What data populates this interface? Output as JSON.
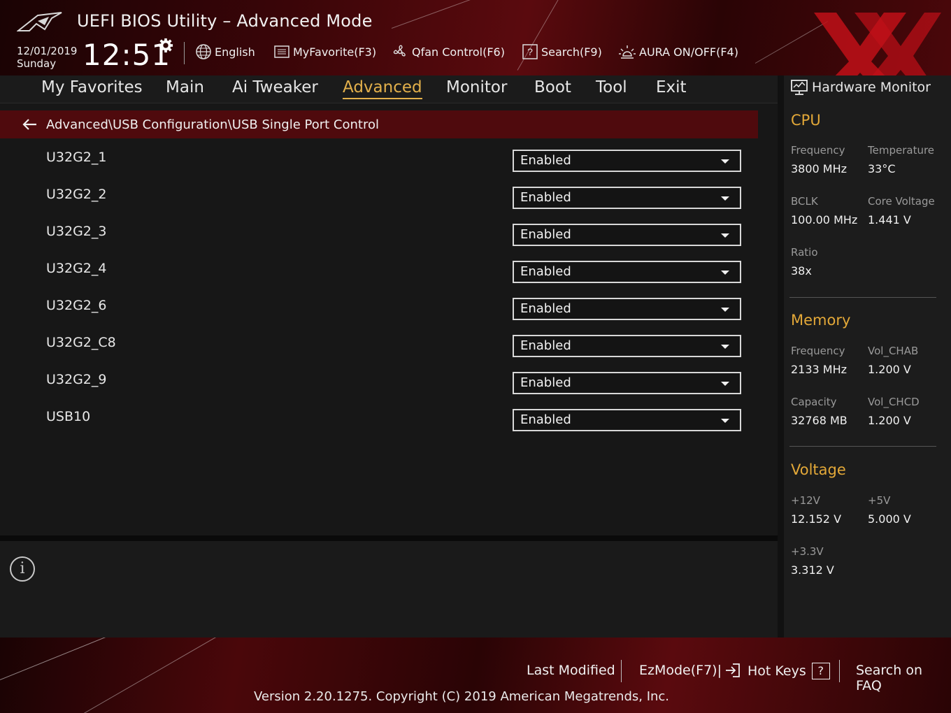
{
  "header": {
    "title": "UEFI BIOS Utility – Advanced Mode",
    "date": "12/01/2019",
    "day": "Sunday",
    "time": "12:51",
    "toolbar": {
      "language": "English",
      "myfavorite": "MyFavorite(F3)",
      "qfan": "Qfan Control(F6)",
      "search": "Search(F9)",
      "aura": "AURA ON/OFF(F4)"
    }
  },
  "tabs": [
    {
      "label": "My Favorites"
    },
    {
      "label": "Main"
    },
    {
      "label": "Ai Tweaker"
    },
    {
      "label": "Advanced",
      "active": true
    },
    {
      "label": "Monitor"
    },
    {
      "label": "Boot"
    },
    {
      "label": "Tool"
    },
    {
      "label": "Exit"
    }
  ],
  "breadcrumb": "Advanced\\USB Configuration\\USB Single Port Control",
  "settings": [
    {
      "label": "U32G2_1",
      "value": "Enabled"
    },
    {
      "label": "U32G2_2",
      "value": "Enabled"
    },
    {
      "label": "U32G2_3",
      "value": "Enabled"
    },
    {
      "label": "U32G2_4",
      "value": "Enabled"
    },
    {
      "label": "U32G2_6",
      "value": "Enabled"
    },
    {
      "label": "U32G2_C8",
      "value": "Enabled"
    },
    {
      "label": "U32G2_9",
      "value": "Enabled"
    },
    {
      "label": "USB10",
      "value": "Enabled"
    }
  ],
  "hwmon": {
    "title": "Hardware Monitor",
    "cpu": {
      "heading": "CPU",
      "frequency_label": "Frequency",
      "frequency": "3800 MHz",
      "temperature_label": "Temperature",
      "temperature": "33°C",
      "bclk_label": "BCLK",
      "bclk": "100.00 MHz",
      "core_voltage_label": "Core Voltage",
      "core_voltage": "1.441 V",
      "ratio_label": "Ratio",
      "ratio": "38x"
    },
    "memory": {
      "heading": "Memory",
      "frequency_label": "Frequency",
      "frequency": "2133 MHz",
      "vol_chab_label": "Vol_CHAB",
      "vol_chab": "1.200 V",
      "capacity_label": "Capacity",
      "capacity": "32768 MB",
      "vol_chcd_label": "Vol_CHCD",
      "vol_chcd": "1.200 V"
    },
    "voltage": {
      "heading": "Voltage",
      "v12_label": "+12V",
      "v12": "12.152 V",
      "v5_label": "+5V",
      "v5": "5.000 V",
      "v33_label": "+3.3V",
      "v33": "3.312 V"
    }
  },
  "footer": {
    "last_modified": "Last Modified",
    "ezmode": "EzMode(F7)|",
    "hotkeys": "Hot Keys",
    "hotkeys_key": "?",
    "faq": "Search on FAQ",
    "copyright": "Version 2.20.1275. Copyright (C) 2019 American Megatrends, Inc."
  },
  "colors": {
    "accent": "#e3b04b",
    "section_heading": "#e3a838",
    "breadcrumb_bg": "#4f0a0d",
    "header_red": "#5a0a0e"
  },
  "icons": [
    "rog-logo-icon",
    "gear-icon",
    "globe-icon",
    "myfavorite-icon",
    "fan-icon",
    "search-help-icon",
    "aura-icon",
    "rog-x-logo",
    "back-arrow-icon",
    "monitor-icon",
    "info-icon",
    "exit-arrow-icon"
  ]
}
